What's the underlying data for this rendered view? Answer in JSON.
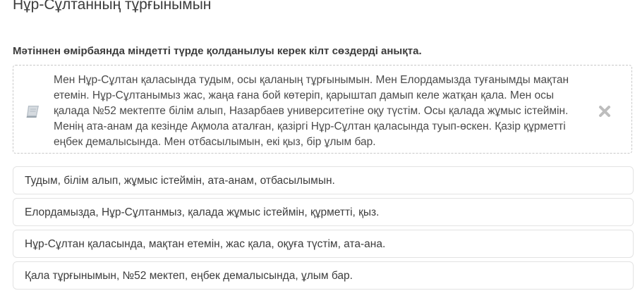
{
  "header": {
    "title": "Нұр-Сұлтанның тұрғынымын"
  },
  "question": {
    "text": "Мәтіннен өмірбаянда міндетті түрде қолданылуы керек кілт сөздерді анықта."
  },
  "reading": {
    "icon": "book-icon",
    "text": "Мен Нұр-Сұлтан қаласында тудым, осы қаланың тұрғынымын. Мен Елордамызда туғанымды мақтан етемін. Нұр-Сұлтанымыз жас, жаңа ғана бой көтеріп, қарыштап дамып келе жатқан қала. Мен осы қалада №52 мектепте білім алып, Назарбаев университетіне оқу түстім. Осы қалада жұмыс істеймін. Менің ата-анам да кезінде Ақмола аталған, қазіргі Нұр-Сұлтан қаласында туып-өскен. Қазір құрметті еңбек демалысында. Мен отбасылымын, екі қыз, бір ұлым бар.",
    "close_icon": "close-icon"
  },
  "options": [
    {
      "label": "Тудым, білім алып, жұмыс істеймін, ата-анам, отбасылымын."
    },
    {
      "label": "Елордамызда, Нұр-Сұлтанмыз, қалада жұмыс істеймін, құрметті, қыз."
    },
    {
      "label": "Нұр-Сұлтан қаласында, мақтан етемін, жас қала, оқуға түстім, ата-ана."
    },
    {
      "label": "Қала тұрғынымын, №52 мектеп, еңбек демалысында, ұлым бар."
    }
  ],
  "colors": {
    "text": "#3c3c3c",
    "icon": "#bdbdbd",
    "border": "#e3e3e3"
  }
}
